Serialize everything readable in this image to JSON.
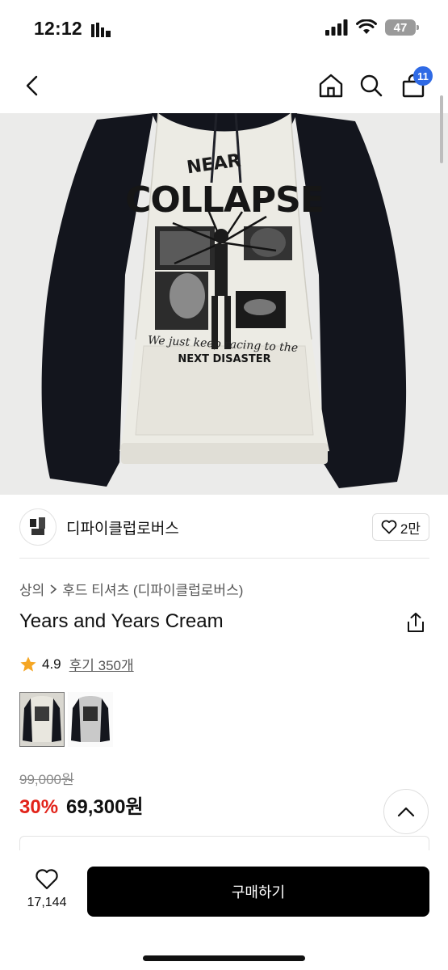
{
  "status_bar": {
    "time": "12:12",
    "battery": "47"
  },
  "nav": {
    "cart_count": "11"
  },
  "seller": {
    "name": "디파이클럽로버스",
    "like_count": "2만"
  },
  "breadcrumb": {
    "category": "상의",
    "subcategory": "후드 티셔츠 (디파이클럽로버스)"
  },
  "product": {
    "title": "Years and Years Cream",
    "image_text": {
      "top": "NEAR",
      "headline": "COLLAPSE",
      "tagline": "We just keep racing to the",
      "footer": "NEXT DISASTER"
    },
    "rating": {
      "score": "4.9",
      "reviews_label": "후기 350개"
    },
    "original_price": "99,000원",
    "discount": "30%",
    "price": "69,300원"
  },
  "bottom_bar": {
    "wish_count": "17,144",
    "buy_label": "구매하기"
  },
  "colors": {
    "accent_blue": "#2f6ae5",
    "discount_red": "#e2231a",
    "star": "#f5a623",
    "buy_button": "#000000"
  },
  "icons": [
    "back-icon",
    "home-icon",
    "search-icon",
    "cart-icon",
    "heart-icon",
    "chevron-right-icon",
    "share-icon",
    "star-icon",
    "chevron-up-icon"
  ]
}
